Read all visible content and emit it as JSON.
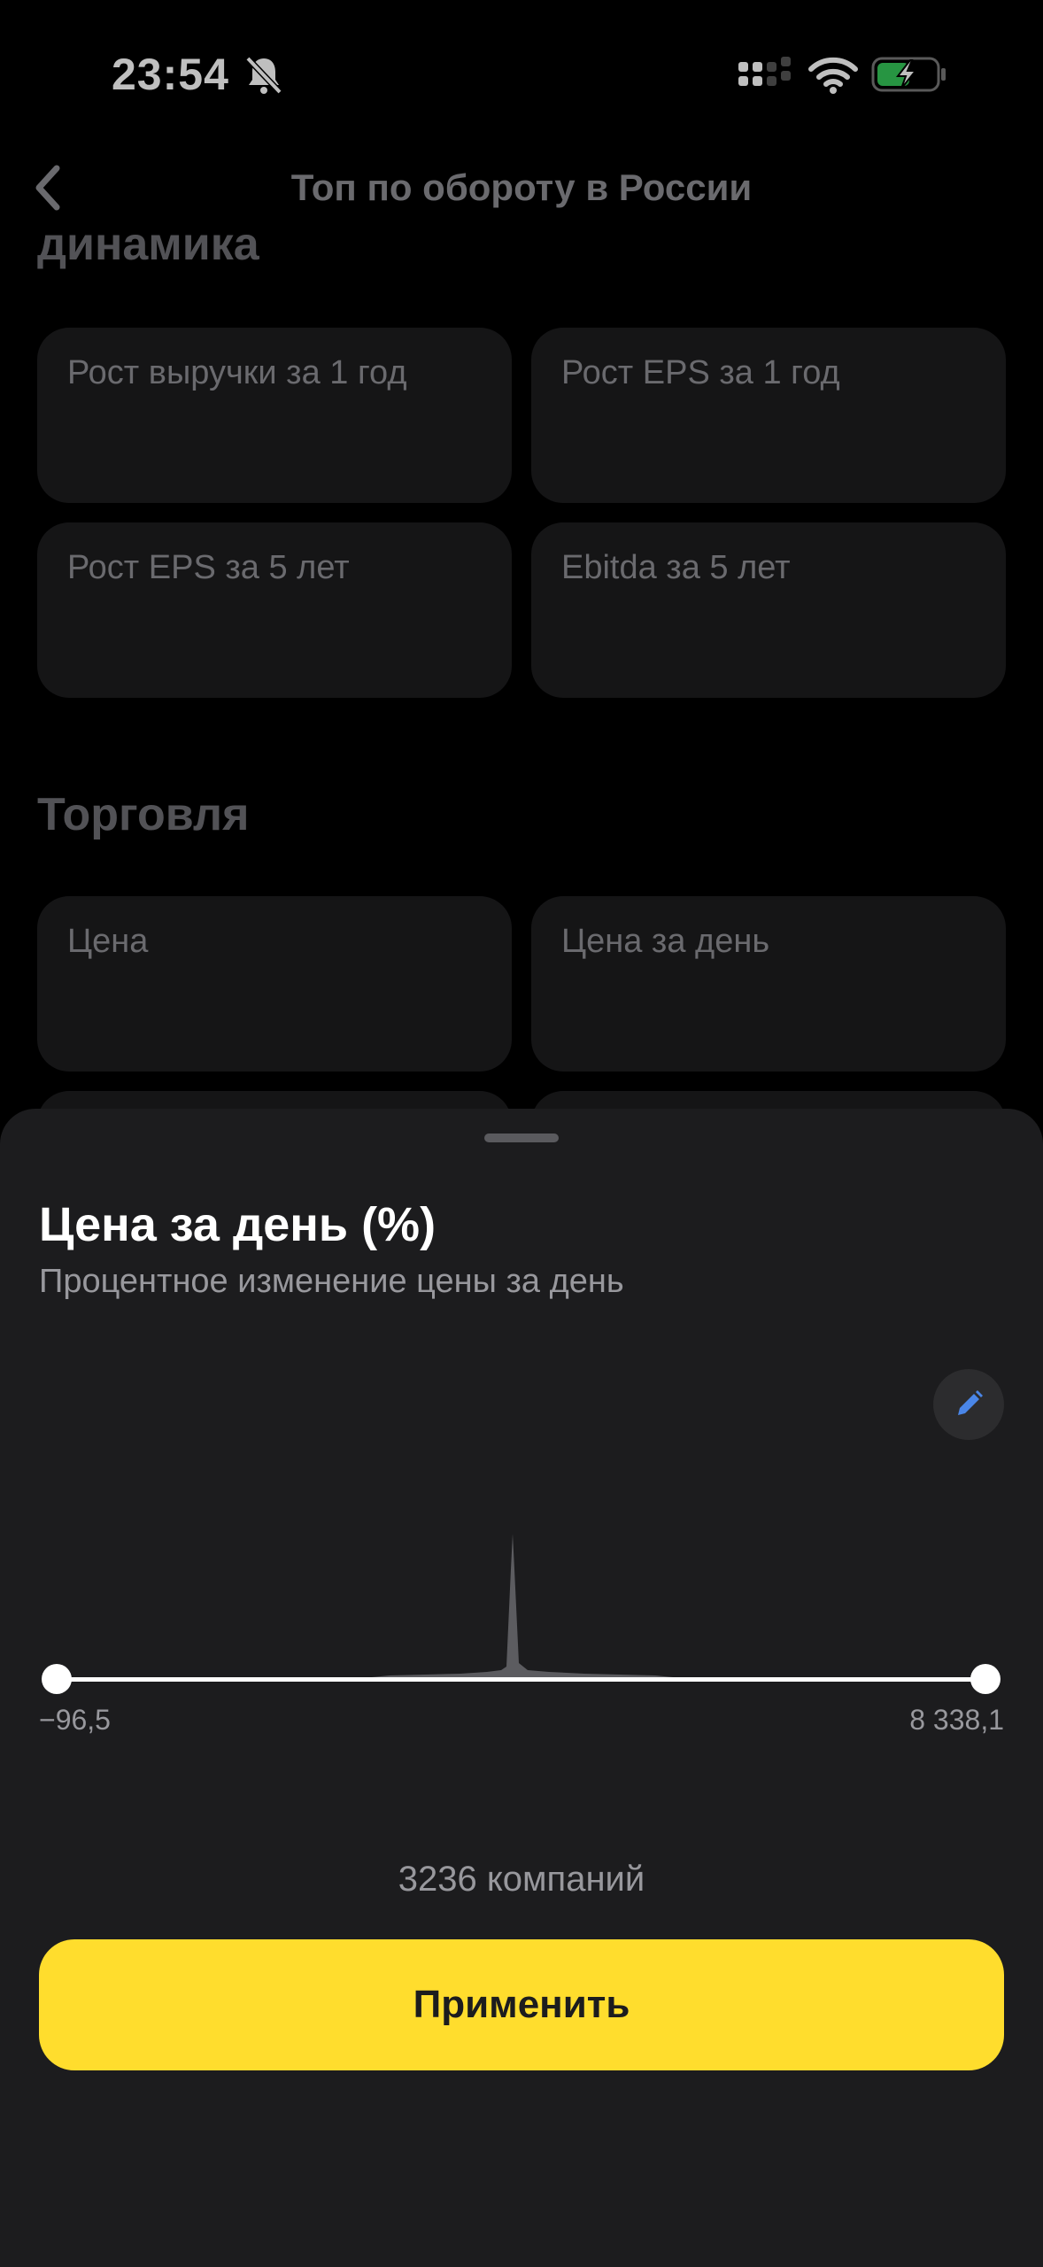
{
  "status_bar": {
    "time": "23:54"
  },
  "nav": {
    "title": "Топ по обороту в России"
  },
  "sections": {
    "dynamics": "динамика",
    "trading": "Торговля"
  },
  "filters": [
    "Рост выручки за 1 год",
    "Рост EPS за 1 год",
    "Рост EPS за 5 лет",
    "Ebitda за 5 лет",
    "Цена",
    "Цена за день"
  ],
  "sheet": {
    "title": "Цена за день (%)",
    "subtitle": "Процентное изменение цены за день",
    "range_min": "−96,5",
    "range_max": "8 338,1",
    "count": "3236 компаний",
    "apply_label": "Применить"
  },
  "colors": {
    "accent": "#ffdd2d",
    "sheet_bg": "#1c1c1e",
    "edit_icon": "#4a86e8"
  }
}
